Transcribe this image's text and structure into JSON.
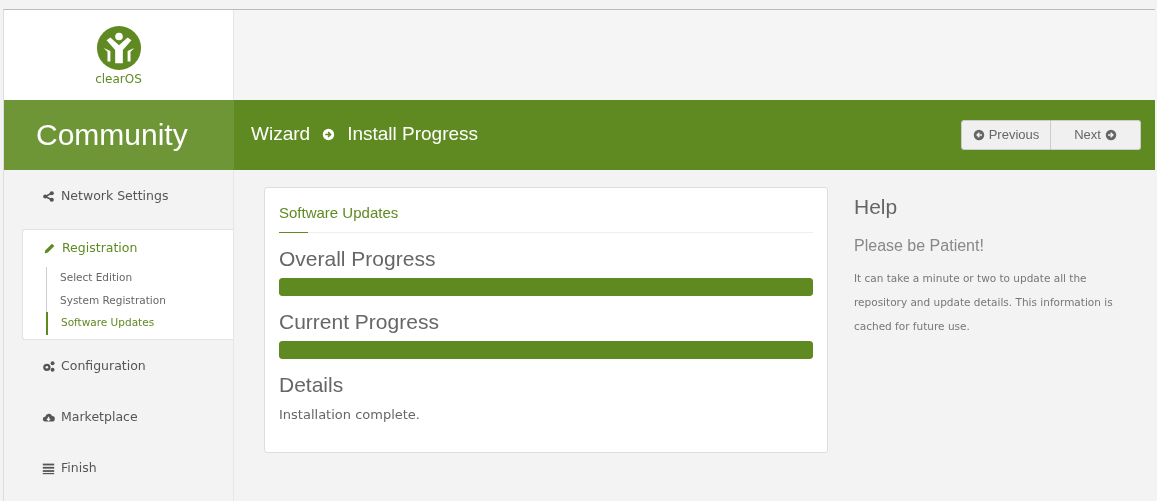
{
  "logo": {
    "text": "clearOS"
  },
  "edition": "Community",
  "breadcrumb": [
    "Wizard",
    "Install Progress"
  ],
  "buttons": [
    {
      "label": "Previous",
      "kind": "previous"
    },
    {
      "label": "Next",
      "kind": "next"
    }
  ],
  "sidebar": {
    "items": [
      {
        "label": "Network Settings",
        "selected": false
      },
      {
        "label": "Registration",
        "selected": true,
        "children": [
          {
            "label": "Select Edition",
            "selected": false
          },
          {
            "label": "System Registration",
            "selected": false
          },
          {
            "label": "Software Updates",
            "selected": true
          }
        ]
      },
      {
        "label": "Configuration",
        "selected": false
      },
      {
        "label": "Marketplace",
        "selected": false
      },
      {
        "label": "Finish",
        "selected": false
      }
    ]
  },
  "panel": {
    "title": "Software Updates",
    "progress": [
      {
        "label": "Overall Progress",
        "level": 1.0
      },
      {
        "label": "Current Progress",
        "level": 1.0
      }
    ],
    "details_heading": "Details",
    "details": "Installation complete."
  },
  "help": {
    "title": "Help",
    "subtitle": "Please be Patient!",
    "text": "It can take a minute or two to update all the repository and update details. This information is cached for future use."
  }
}
